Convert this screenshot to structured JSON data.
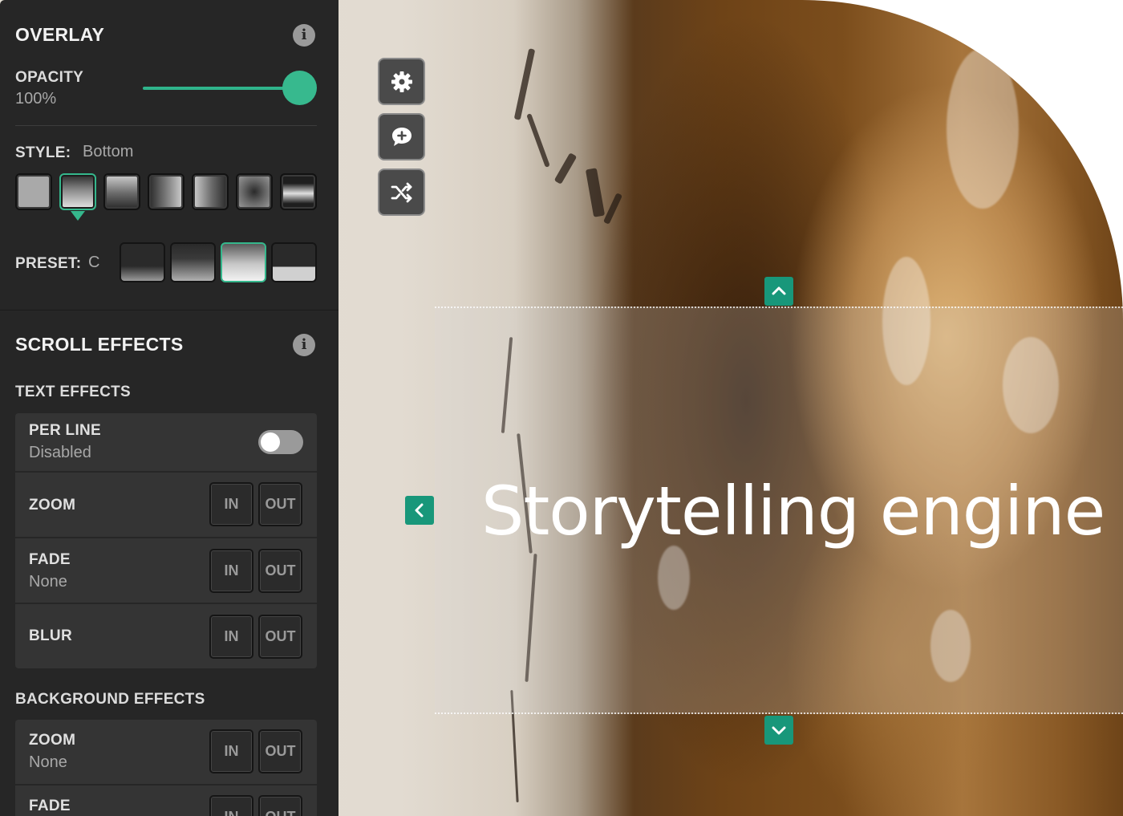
{
  "overlay": {
    "title": "OVERLAY",
    "opacity_label": "OPACITY",
    "opacity_value": "100%",
    "opacity_fraction": 1.0,
    "style_label": "STYLE:",
    "style_value": "Bottom",
    "style_selected_index": 1,
    "preset_label": "PRESET:",
    "preset_value": "C",
    "preset_selected_index": 2
  },
  "scroll_effects": {
    "title": "SCROLL EFFECTS",
    "text_effects_heading": "TEXT EFFECTS",
    "text_effects": [
      {
        "name": "PER LINE",
        "value": "Disabled",
        "control": "toggle",
        "enabled": false
      },
      {
        "name": "ZOOM",
        "value": "",
        "control": "in-out"
      },
      {
        "name": "FADE",
        "value": "None",
        "control": "in-out"
      },
      {
        "name": "BLUR",
        "value": "",
        "control": "in-out"
      }
    ],
    "background_effects_heading": "BACKGROUND EFFECTS",
    "background_effects": [
      {
        "name": "ZOOM",
        "value": "None",
        "control": "in-out"
      },
      {
        "name": "FADE",
        "value": "",
        "control": "in-out"
      }
    ],
    "in_label": "IN",
    "out_label": "OUT"
  },
  "toolbar": {
    "icons": [
      "gear-icon",
      "comment-add-icon",
      "shuffle-icon"
    ]
  },
  "canvas": {
    "headline": "Storytelling engine"
  },
  "colors": {
    "accent": "#35b78c",
    "panel_bg": "#262626",
    "handle": "#18977a"
  }
}
